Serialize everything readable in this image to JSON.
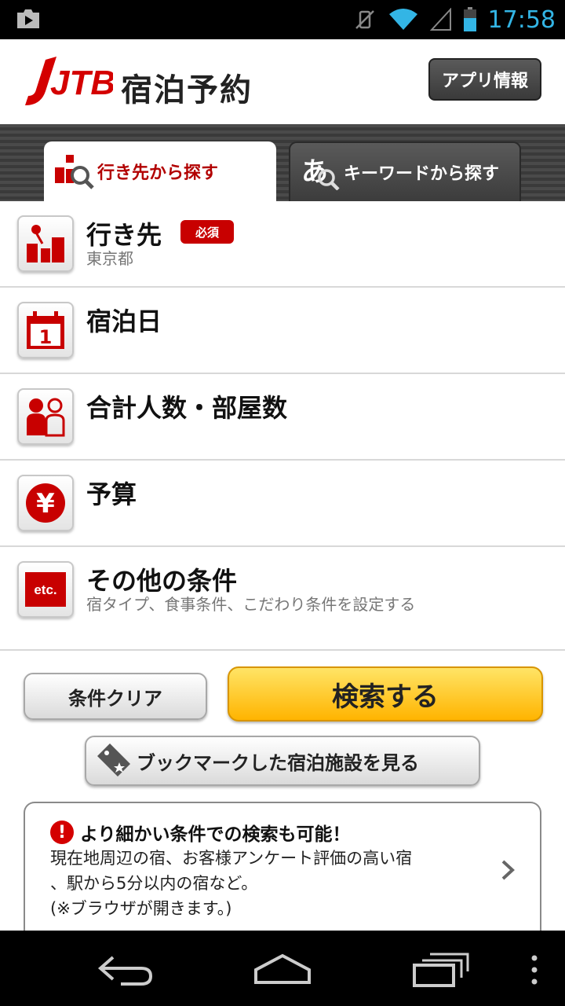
{
  "status_bar": {
    "time": "17:58"
  },
  "header": {
    "logo_text": "JTB",
    "title": "宿泊予約",
    "info_button": "アプリ情報"
  },
  "tabs": [
    {
      "label": "行き先から探す",
      "active": true,
      "icon": "destination-search-icon"
    },
    {
      "label": "キーワードから探す",
      "active": false,
      "icon": "keyword-search-icon"
    }
  ],
  "rows": [
    {
      "title": "行き先",
      "badge": "必須",
      "subtitle": "東京都",
      "icon": "destination-icon"
    },
    {
      "title": "宿泊日",
      "subtitle": "",
      "icon": "calendar-icon",
      "calendar_day": "1"
    },
    {
      "title": "合計人数・部屋数",
      "subtitle": "",
      "icon": "people-icon"
    },
    {
      "title": "予算",
      "subtitle": "",
      "icon": "yen-icon",
      "yen_symbol": "¥"
    },
    {
      "title": "その他の条件",
      "subtitle": "宿タイプ、食事条件、こだわり条件を設定する",
      "icon": "etc-icon",
      "etc_text": "etc."
    }
  ],
  "actions": {
    "clear": "条件クリア",
    "search": "検索する",
    "bookmark": "ブックマークした宿泊施設を見る"
  },
  "notice": {
    "title": "より細かい条件での検索も可能！",
    "lines": [
      "現在地周辺の宿、お客様アンケート評価の高い宿",
      "、駅から5分以内の宿など。",
      "(※ブラウザが開きます。)"
    ],
    "warn_symbol": "!"
  },
  "colors": {
    "accent_red": "#c80000",
    "search_yellow": "#ffc000",
    "status_blue": "#33b5e5"
  }
}
